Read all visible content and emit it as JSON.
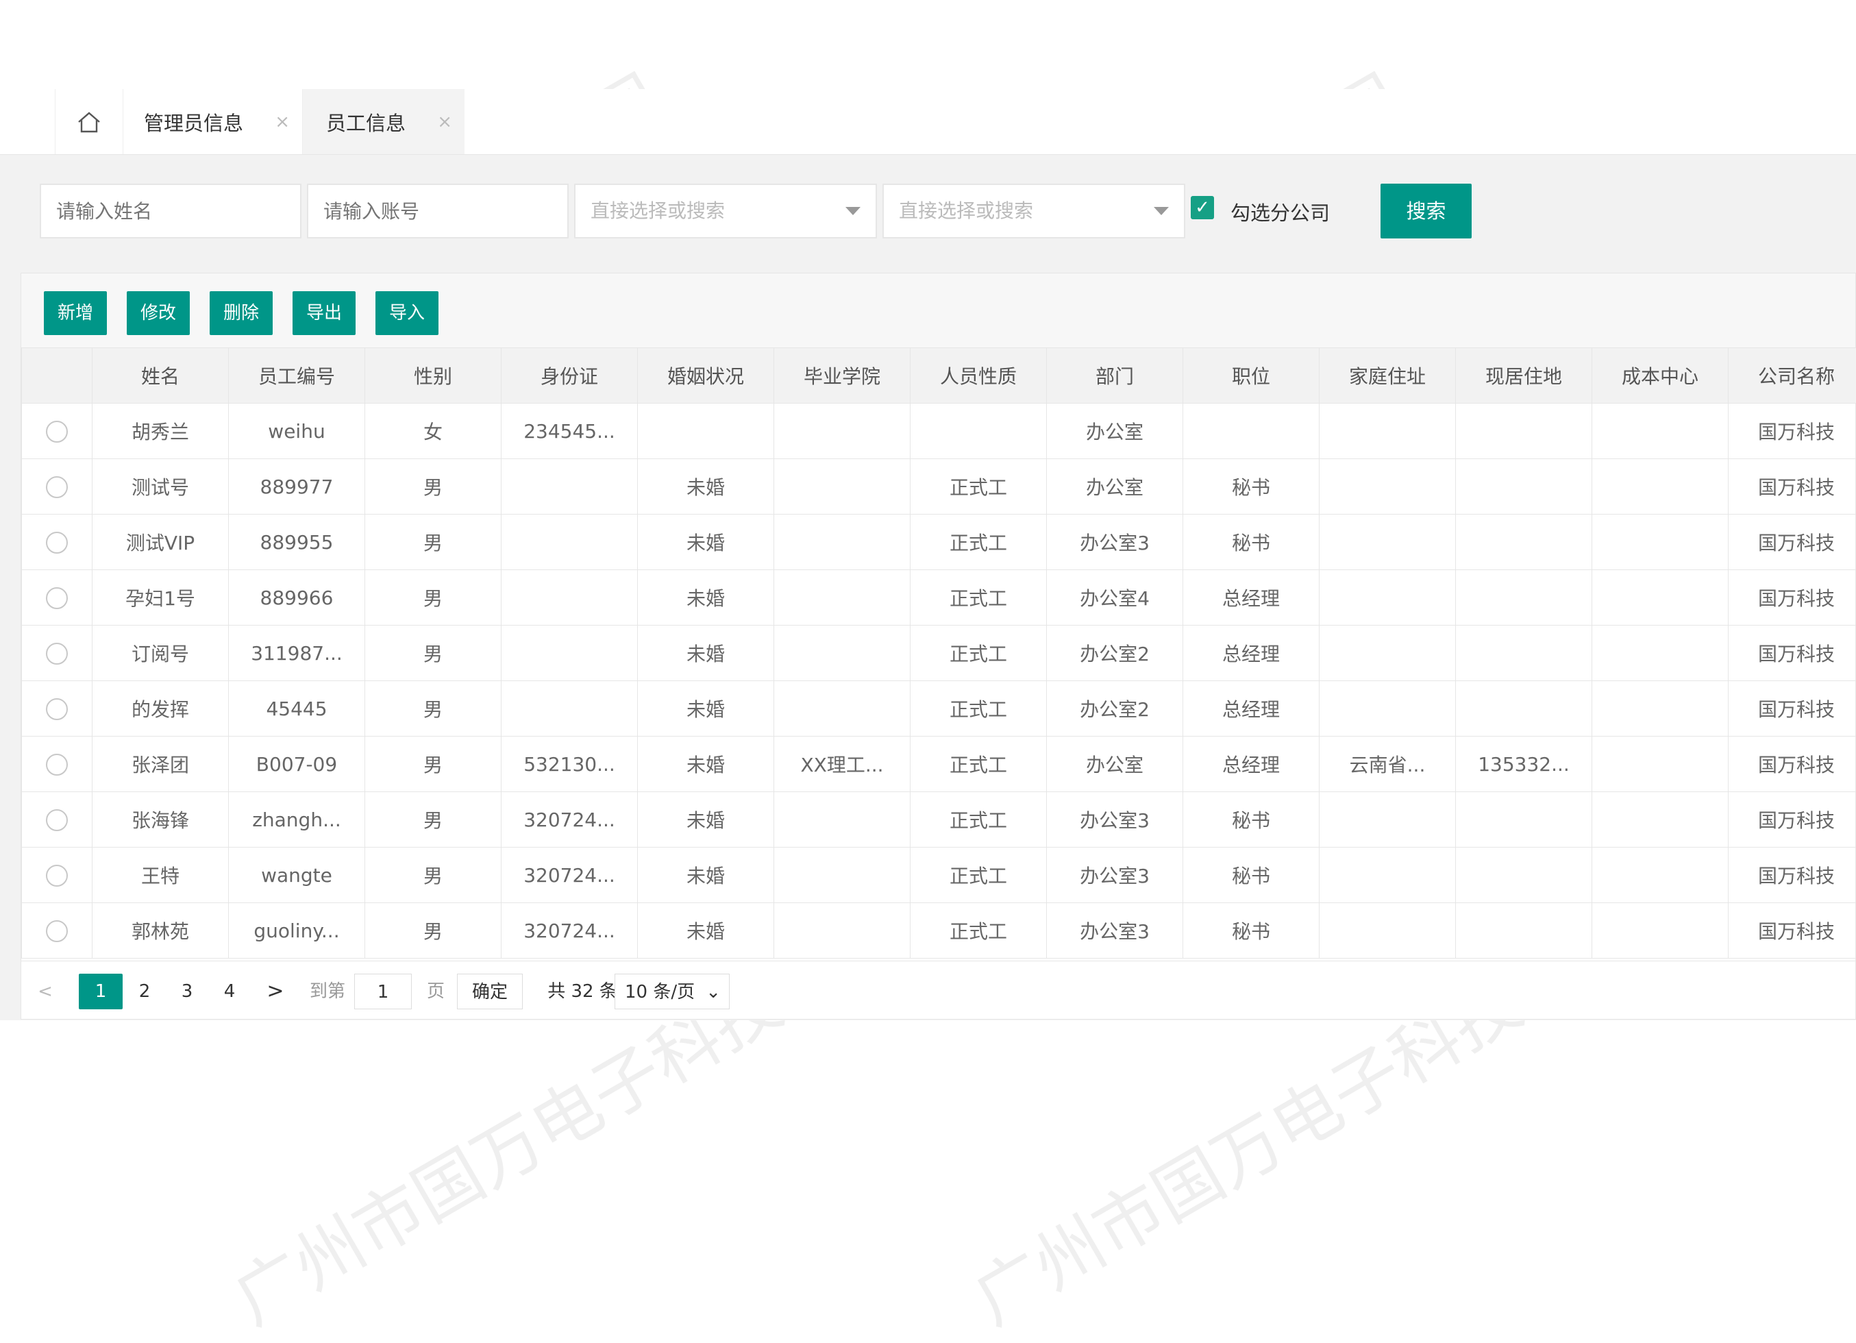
{
  "tabs": [
    {
      "label": "管理员信息",
      "close": "×"
    },
    {
      "label": "员工信息",
      "close": "×"
    }
  ],
  "search": {
    "name_placeholder": "请输入姓名",
    "account_placeholder": "请输入账号",
    "select1_placeholder": "直接选择或搜索",
    "select2_placeholder": "直接选择或搜索",
    "checkbox_label": "勾选分公司",
    "checkbox_checked": true,
    "search_button": "搜索"
  },
  "toolbar": {
    "add": "新增",
    "edit": "修改",
    "delete": "删除",
    "export": "导出",
    "import": "导入"
  },
  "table": {
    "columns": [
      "姓名",
      "员工编号",
      "性别",
      "身份证",
      "婚姻状况",
      "毕业学院",
      "人员性质",
      "部门",
      "职位",
      "家庭住址",
      "现居住地",
      "成本中心",
      "公司名称"
    ],
    "rows": [
      [
        "胡秀兰",
        "weihu",
        "女",
        "234545...",
        "",
        "",
        "",
        "办公室",
        "",
        "",
        "",
        "",
        "国万科技"
      ],
      [
        "测试号",
        "889977",
        "男",
        "",
        "未婚",
        "",
        "正式工",
        "办公室",
        "秘书",
        "",
        "",
        "",
        "国万科技"
      ],
      [
        "测试VIP",
        "889955",
        "男",
        "",
        "未婚",
        "",
        "正式工",
        "办公室3",
        "秘书",
        "",
        "",
        "",
        "国万科技"
      ],
      [
        "孕妇1号",
        "889966",
        "男",
        "",
        "未婚",
        "",
        "正式工",
        "办公室4",
        "总经理",
        "",
        "",
        "",
        "国万科技"
      ],
      [
        "订阅号",
        "311987...",
        "男",
        "",
        "未婚",
        "",
        "正式工",
        "办公室2",
        "总经理",
        "",
        "",
        "",
        "国万科技"
      ],
      [
        "的发挥",
        "45445",
        "男",
        "",
        "未婚",
        "",
        "正式工",
        "办公室2",
        "总经理",
        "",
        "",
        "",
        "国万科技"
      ],
      [
        "张泽团",
        "B007-09",
        "男",
        "532130...",
        "未婚",
        "XX理工...",
        "正式工",
        "办公室",
        "总经理",
        "云南省...",
        "135332...",
        "",
        "国万科技"
      ],
      [
        "张海锋",
        "zhangh...",
        "男",
        "320724...",
        "未婚",
        "",
        "正式工",
        "办公室3",
        "秘书",
        "",
        "",
        "",
        "国万科技"
      ],
      [
        "王特",
        "wangte",
        "男",
        "320724...",
        "未婚",
        "",
        "正式工",
        "办公室3",
        "秘书",
        "",
        "",
        "",
        "国万科技"
      ],
      [
        "郭林苑",
        "guoliny...",
        "男",
        "320724...",
        "未婚",
        "",
        "正式工",
        "办公室3",
        "秘书",
        "",
        "",
        "",
        "国万科技"
      ]
    ]
  },
  "pager": {
    "prev": "<",
    "pages": [
      "1",
      "2",
      "3",
      "4"
    ],
    "current": "1",
    "next": ">",
    "goto_label": "到第",
    "goto_value": "1",
    "page_unit": "页",
    "confirm": "确定",
    "total": "共 32 条",
    "page_size": "10 条/页"
  },
  "watermark": "广州市国万电子科技有限公司",
  "colors": {
    "accent": "#009688"
  }
}
